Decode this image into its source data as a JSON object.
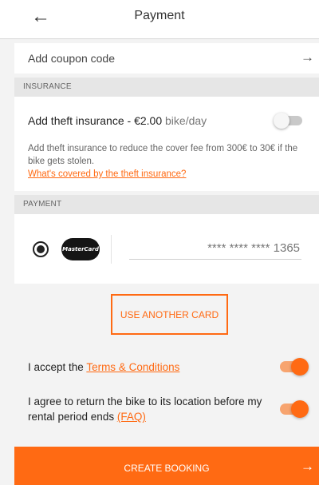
{
  "header": {
    "back_icon": "arrow-left-icon",
    "title": "Payment"
  },
  "coupon": {
    "label": "Add coupon code",
    "arrow_icon": "arrow-right-icon"
  },
  "insurance": {
    "section_label": "INSURANCE",
    "title_prefix": "Add theft insurance - ",
    "price": "€2.00",
    "unit": " bike/day",
    "enabled": false,
    "description": "Add theft insurance to reduce the cover fee from 300€ to 30€ if the bike gets stolen.",
    "link": "What's covered by the theft insurance?"
  },
  "payment": {
    "section_label": "PAYMENT",
    "card_brand": "MasterCard",
    "card_number": "**** **** **** 1365",
    "selected": true,
    "another_card_label": "USE ANOTHER CARD"
  },
  "agreements": {
    "terms_prefix": "I accept the ",
    "terms_link": "Terms & Conditions",
    "terms_accepted": true,
    "return_text": "I agree to return the bike to its location before my rental period ends ",
    "return_link": "(FAQ)",
    "return_accepted": true
  },
  "footer": {
    "create_label": "CREATE BOOKING",
    "arrow_icon": "arrow-right-icon"
  },
  "colors": {
    "accent": "#ff6a13",
    "background": "#f3f3f3",
    "section_header": "#e6e6e6"
  }
}
